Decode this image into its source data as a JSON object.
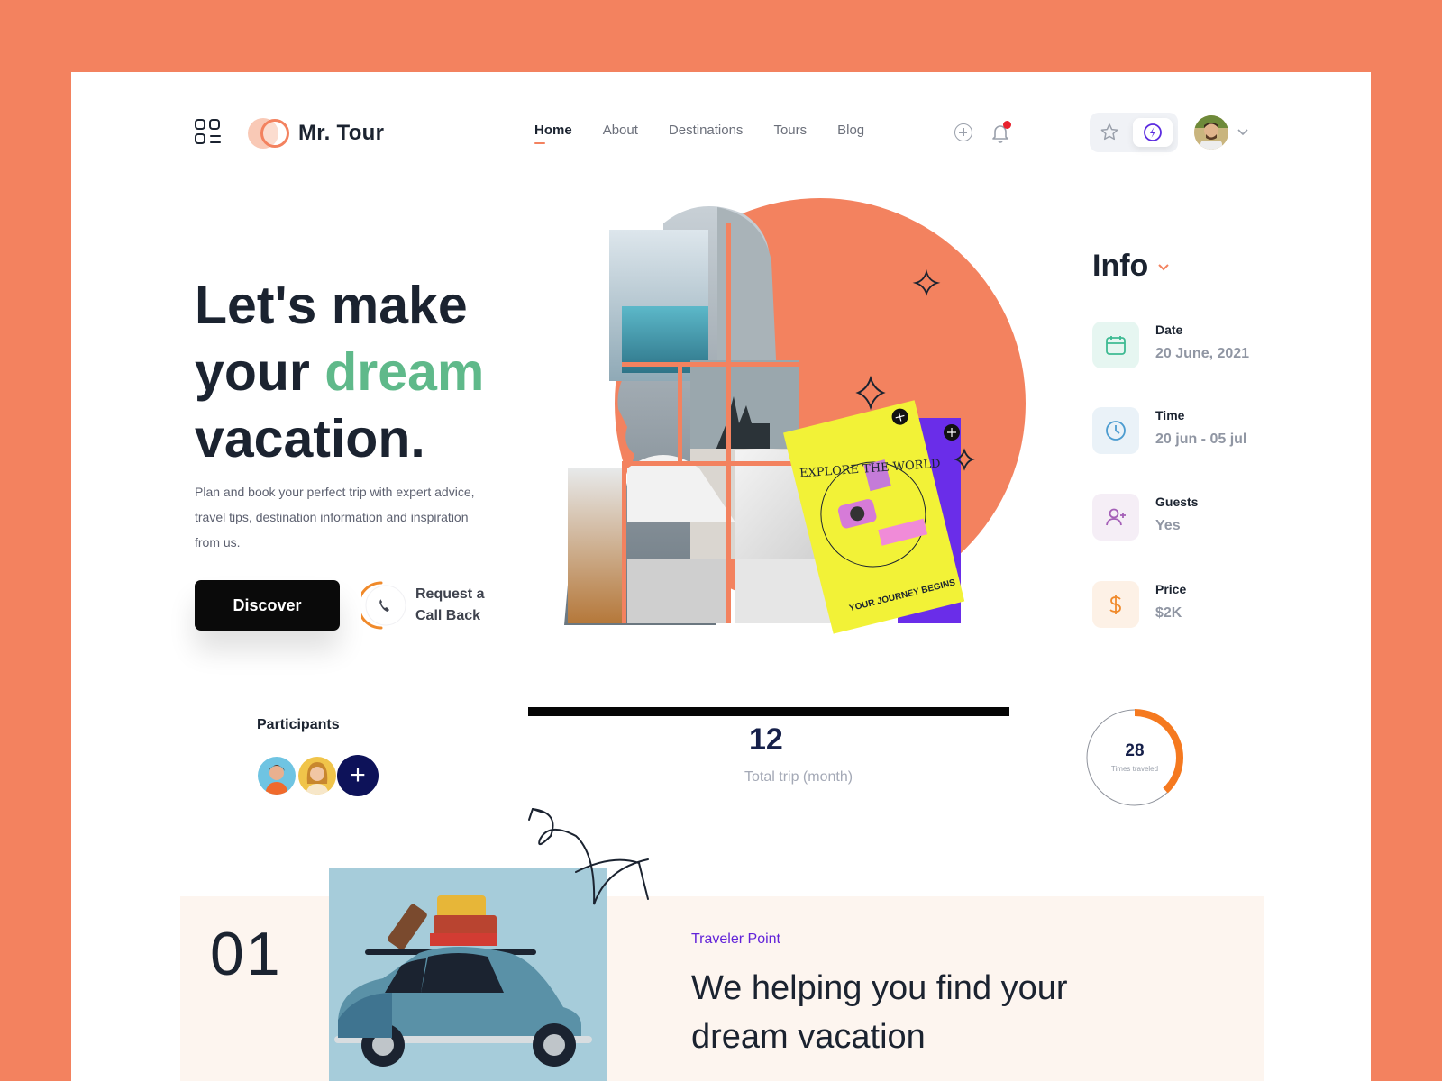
{
  "brand": {
    "name": "Mr. Tour",
    "menu_icon": "grid-menu-icon",
    "accent": "#F3825F",
    "dark": "#1B2330",
    "green": "#5FB98A"
  },
  "nav": {
    "items": [
      "Home",
      "About",
      "Destinations",
      "Tours",
      "Blog"
    ],
    "active": "Home"
  },
  "header_icons": [
    "add-location-icon",
    "bell-icon",
    "star-icon",
    "compass-icon",
    "chevron-down-icon"
  ],
  "hero": {
    "line1": "Let's make",
    "line2_a": "your ",
    "line2_b": "dream",
    "line3": "vacation.",
    "description": "Plan and book your perfect trip with expert advice, travel tips, destination information and inspiration from us.",
    "discover_label": "Discover",
    "callback_line1": "Request a",
    "callback_line2": "Call Back"
  },
  "book": {
    "arc_text": "EXPLORE THE WORLD",
    "bottom_text": "YOUR JOURNEY BEGINS",
    "color": "#F2F237",
    "back_color": "#6A2DE9"
  },
  "info": {
    "title": "Info",
    "rows": [
      {
        "label": "Date",
        "value": "20 June, 2021",
        "icon": "calendar-icon",
        "bg": "#E6F6F1",
        "fg": "#3DBA92"
      },
      {
        "label": "Time",
        "value": "20 jun - 05 jul",
        "icon": "clock-icon",
        "bg": "#EAF2F8",
        "fg": "#4C9CD0"
      },
      {
        "label": "Guests",
        "value": "Yes",
        "icon": "add-user-icon",
        "bg": "#F5EEF6",
        "fg": "#A45FB7"
      },
      {
        "label": "Price",
        "value": "$2K",
        "icon": "dollar-icon",
        "bg": "#FDF1E6",
        "fg": "#F08A2B"
      }
    ]
  },
  "participants": {
    "label": "Participants",
    "add_symbol": "+"
  },
  "stats": {
    "total_trip": "12",
    "total_trip_label": "Total trip (month)",
    "times_traveled": "28",
    "times_traveled_label": "Times traveled",
    "gauge_fraction": 0.38
  },
  "feature": {
    "number": "01",
    "kicker": "Traveler Point",
    "title": "We helping you find your dream vacation"
  }
}
